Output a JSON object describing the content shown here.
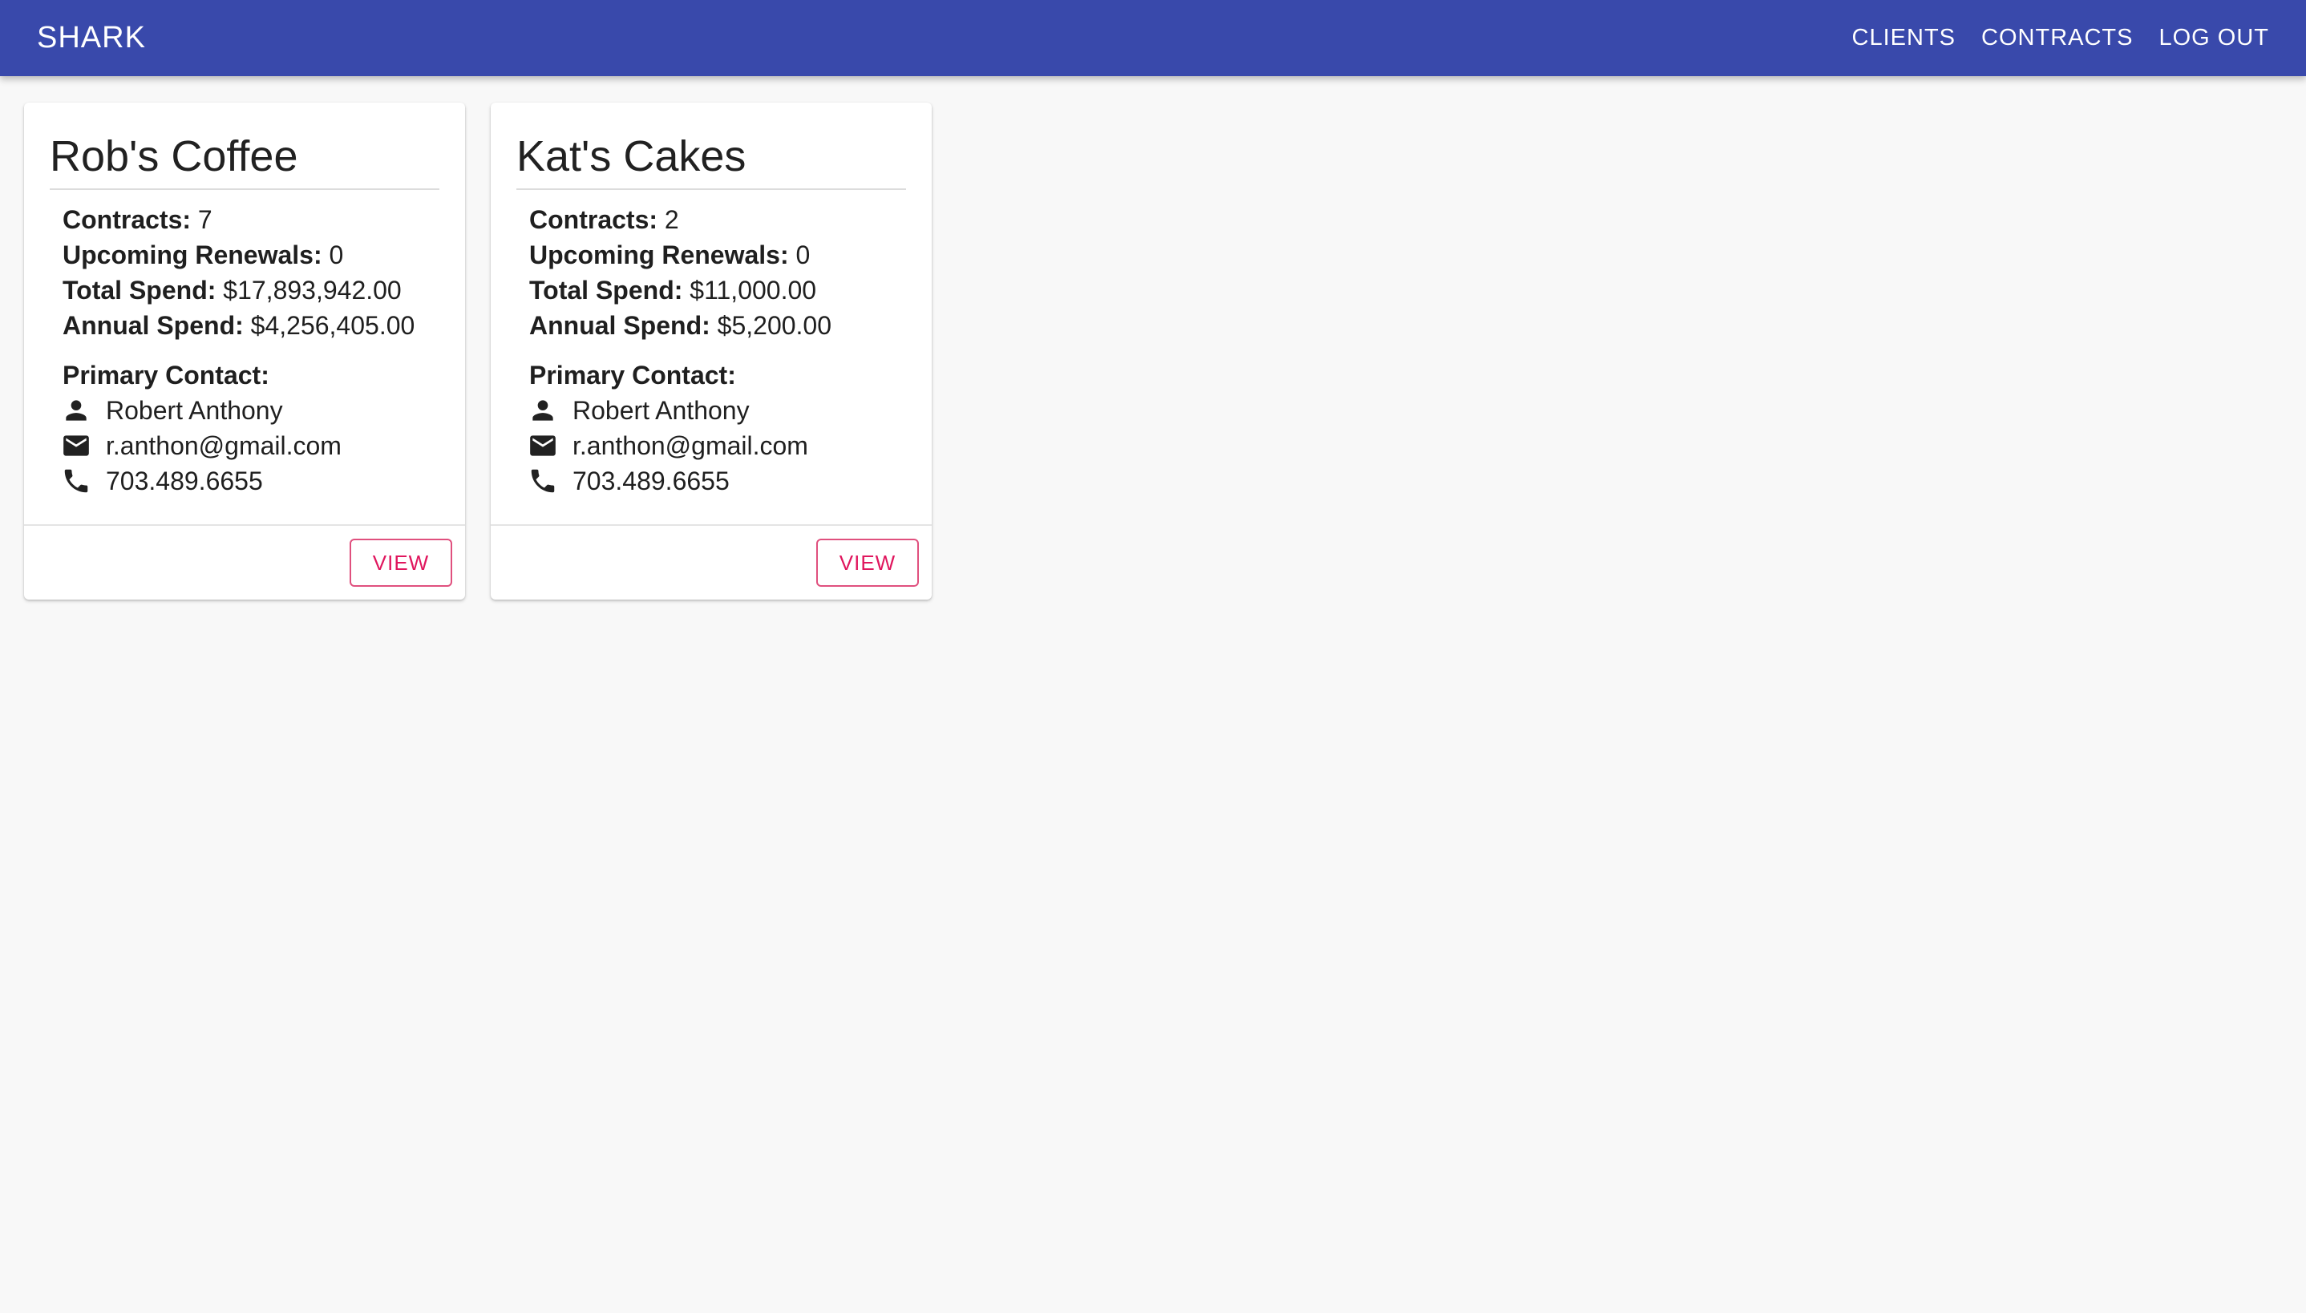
{
  "appbar": {
    "brand": "SHARK",
    "nav": [
      {
        "label": "CLIENTS"
      },
      {
        "label": "CONTRACTS"
      },
      {
        "label": "LOG OUT"
      }
    ],
    "color": "#3949ab"
  },
  "labels": {
    "contracts": "Contracts:",
    "upcoming_renewals": "Upcoming Renewals:",
    "total_spend": "Total Spend:",
    "annual_spend": "Annual Spend:",
    "primary_contact": "Primary Contact:",
    "view": "VIEW"
  },
  "clients": [
    {
      "name": "Rob's Coffee",
      "contracts": "7",
      "upcoming_renewals": "0",
      "total_spend": "$17,893,942.00",
      "annual_spend": "$4,256,405.00",
      "contact": {
        "name": "Robert Anthony",
        "email": "r.anthon@gmail.com",
        "phone": "703.489.6655"
      }
    },
    {
      "name": "Kat's Cakes",
      "contracts": "2",
      "upcoming_renewals": "0",
      "total_spend": "$11,000.00",
      "annual_spend": "$5,200.00",
      "contact": {
        "name": "Robert Anthony",
        "email": "r.anthon@gmail.com",
        "phone": "703.489.6655"
      }
    }
  ],
  "icons": {
    "person": "person-icon",
    "email": "email-icon",
    "phone": "phone-icon"
  },
  "accent_color": "#e0175e"
}
